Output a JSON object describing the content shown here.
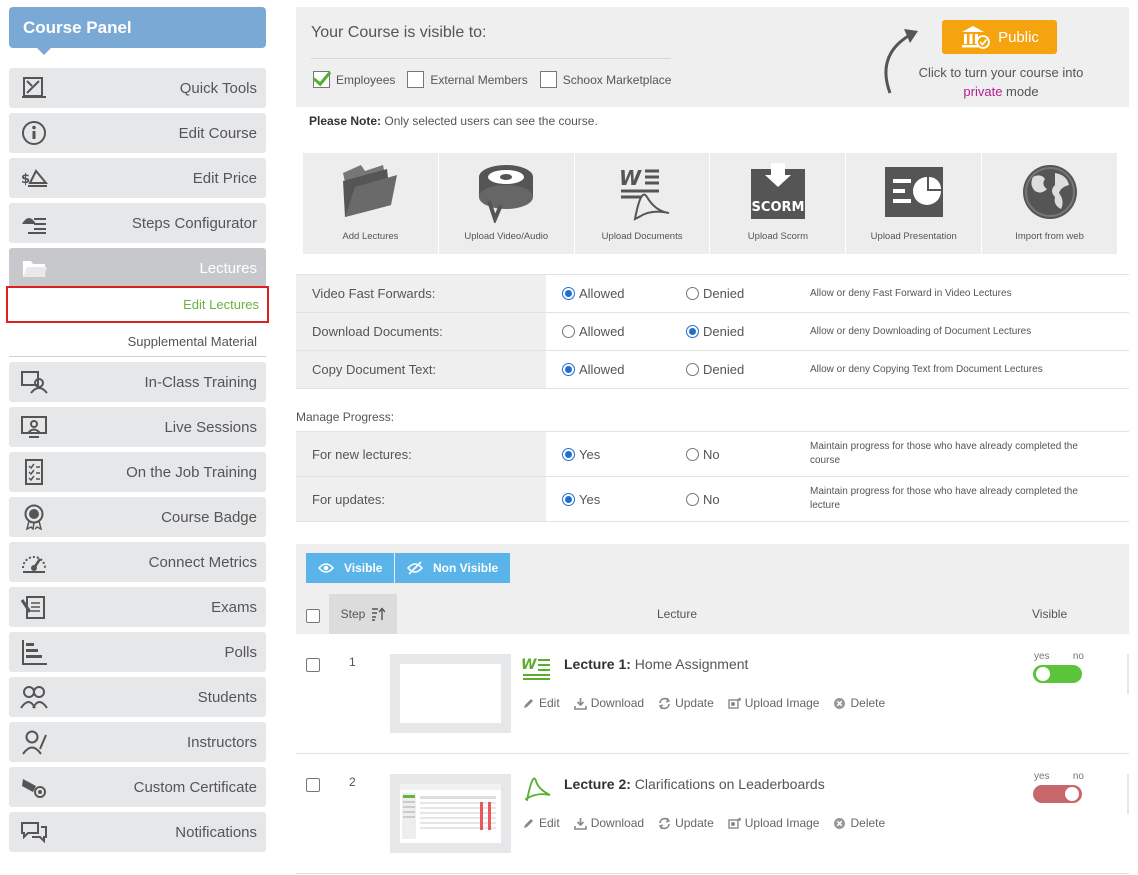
{
  "sidebar": {
    "title": "Course Panel",
    "items": [
      {
        "label": "Quick Tools",
        "icon": "quick-tools-icon"
      },
      {
        "label": "Edit Course",
        "icon": "info-icon"
      },
      {
        "label": "Edit Price",
        "icon": "price-icon"
      },
      {
        "label": "Steps Configurator",
        "icon": "steps-icon"
      },
      {
        "label": "Lectures",
        "icon": "folder-icon"
      },
      {
        "label": "In-Class Training",
        "icon": "classroom-icon"
      },
      {
        "label": "Live Sessions",
        "icon": "monitor-user-icon"
      },
      {
        "label": "On the Job Training",
        "icon": "checklist-icon"
      },
      {
        "label": "Course Badge",
        "icon": "badge-icon"
      },
      {
        "label": "Connect Metrics",
        "icon": "gauge-icon"
      },
      {
        "label": "Exams",
        "icon": "exam-icon"
      },
      {
        "label": "Polls",
        "icon": "bar-chart-icon"
      },
      {
        "label": "Students",
        "icon": "students-icon"
      },
      {
        "label": "Instructors",
        "icon": "instructor-icon"
      },
      {
        "label": "Custom Certificate",
        "icon": "certificate-icon"
      },
      {
        "label": "Notifications",
        "icon": "chat-icon"
      }
    ],
    "sub": {
      "edit_lectures": "Edit Lectures",
      "supplemental": "Supplemental Material"
    }
  },
  "visibility": {
    "title": "Your Course is visible to:",
    "options": [
      {
        "label": "Employees",
        "checked": true
      },
      {
        "label": "External Members",
        "checked": false
      },
      {
        "label": "Schoox Marketplace",
        "checked": false
      }
    ],
    "public_label": "Public",
    "hint_pre": "Click to turn your course into ",
    "hint_private": "private",
    "hint_post": " mode"
  },
  "note": {
    "bold": "Please Note:",
    "text": " Only selected users can see the course."
  },
  "tiles": [
    {
      "label": "Add Lectures",
      "icon": "folder-icon"
    },
    {
      "label": "Upload Video/Audio",
      "icon": "film-reel-icon"
    },
    {
      "label": "Upload Documents",
      "icon": "documents-icon"
    },
    {
      "label": "Upload Scorm",
      "icon": "scorm-box-icon"
    },
    {
      "label": "Upload Presentation",
      "icon": "presentation-icon"
    },
    {
      "label": "Import from web",
      "icon": "globe-icon"
    }
  ],
  "settings": [
    {
      "label": "Video Fast Forwards:",
      "opt1": "Allowed",
      "opt2": "Denied",
      "selected": 1,
      "desc": "Allow or deny Fast Forward in Video Lectures"
    },
    {
      "label": "Download Documents:",
      "opt1": "Allowed",
      "opt2": "Denied",
      "selected": 2,
      "desc": "Allow or deny Downloading of Document Lectures"
    },
    {
      "label": "Copy Document Text:",
      "opt1": "Allowed",
      "opt2": "Denied",
      "selected": 1,
      "desc": "Allow or deny Copying Text from Document Lectures"
    }
  ],
  "manage": {
    "title": "Manage Progress:",
    "rows": [
      {
        "label": "For new lectures:",
        "opt1": "Yes",
        "opt2": "No",
        "selected": 1,
        "desc": "Maintain progress for those who have already completed the course"
      },
      {
        "label": "For updates:",
        "opt1": "Yes",
        "opt2": "No",
        "selected": 1,
        "desc": "Maintain progress for those who have already completed the lecture"
      }
    ]
  },
  "lectures": {
    "visible_btn": "Visible",
    "nonvisible_btn": "Non Visible",
    "col_step": "Step",
    "col_lecture": "Lecture",
    "col_visible": "Visible",
    "yes": "yes",
    "no": "no",
    "actions": [
      "Edit",
      "Download",
      "Update",
      "Upload Image",
      "Delete"
    ],
    "rows": [
      {
        "num": "1",
        "prefix": "Lecture 1:",
        "title": " Home Assignment",
        "type": "word-doc-icon",
        "visible": true
      },
      {
        "num": "2",
        "prefix": "Lecture 2:",
        "title": " Clarifications on Leaderboards",
        "type": "pdf-icon",
        "visible": false
      }
    ]
  }
}
